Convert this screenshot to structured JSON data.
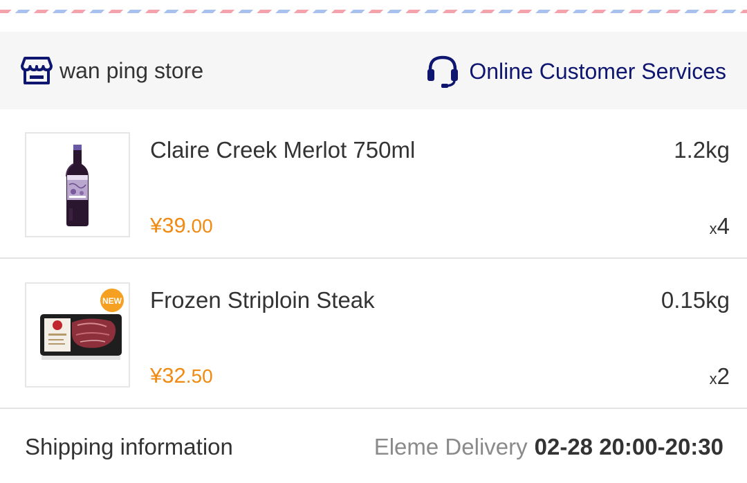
{
  "header": {
    "store_name": "wan ping store",
    "service_label": "Online Customer Services",
    "accent_color": "#0e1670"
  },
  "items": [
    {
      "name": "Claire Creek Merlot 750ml",
      "weight": "1.2kg",
      "price_symbol": "¥",
      "price_int": "39",
      "price_cents": ".00",
      "qty_prefix": "x",
      "qty": "4",
      "image_icon": "wine-bottle-image"
    },
    {
      "name": "Frozen Striploin Steak",
      "weight": "0.15kg",
      "price_symbol": "¥",
      "price_int": "32",
      "price_cents": ".50",
      "qty_prefix": "x",
      "qty": "2",
      "image_icon": "steak-package-image",
      "badge": "NEW"
    }
  ],
  "shipping": {
    "label": "Shipping information",
    "carrier": "Eleme Delivery",
    "time": "02-28 20:00-20:30"
  },
  "colors": {
    "price": "#f08a12",
    "text": "#333333",
    "muted": "#8a8a8a",
    "store_bar_bg": "#f6f6f6"
  }
}
